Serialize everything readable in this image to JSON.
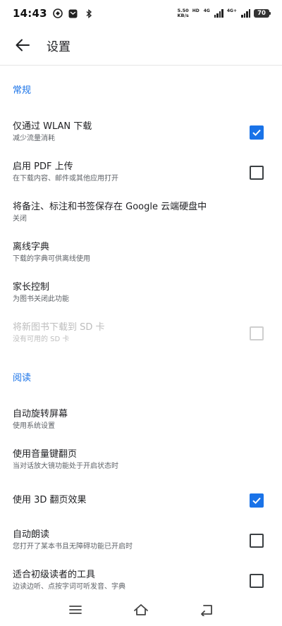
{
  "status_bar": {
    "time": "14:43",
    "speed_value": "5.50",
    "speed_unit": "KB/s",
    "hd_label": "HD",
    "network_1": "4G",
    "network_2": "4G+",
    "battery": "70"
  },
  "app_bar": {
    "title": "设置"
  },
  "sections": {
    "general": {
      "header": "常规",
      "items": [
        {
          "title": "仅通过 WLAN 下载",
          "subtitle": "减少流量消耗",
          "checked": true
        },
        {
          "title": "启用 PDF 上传",
          "subtitle": "在下载内容、邮件或其他应用打开",
          "checked": false
        },
        {
          "title": "将备注、标注和书签保存在 Google 云端硬盘中",
          "subtitle": "关闭"
        },
        {
          "title": "离线字典",
          "subtitle": "下载的字典可供离线使用"
        },
        {
          "title": "家长控制",
          "subtitle": "为图书关闭此功能"
        },
        {
          "title": "将新图书下载到 SD 卡",
          "subtitle": "没有可用的 SD 卡",
          "checked": false,
          "disabled": true
        }
      ]
    },
    "reading": {
      "header": "阅读",
      "items": [
        {
          "title": "自动旋转屏幕",
          "subtitle": "使用系统设置"
        },
        {
          "title": "使用音量键翻页",
          "subtitle": "当对话放大镜功能处于开启状态时"
        },
        {
          "title": "使用 3D 翻页效果",
          "checked": true
        },
        {
          "title": "自动朗读",
          "subtitle": "您打开了某本书且无障碍功能已开启时",
          "checked": false
        },
        {
          "title": "适合初级读者的工具",
          "subtitle": "边读边听、点按字词可听发音、字典",
          "checked": false
        }
      ]
    }
  },
  "colors": {
    "accent": "#1a73e8",
    "text_primary": "#202124",
    "text_secondary": "#5f6368",
    "disabled": "#bdbdbd"
  }
}
